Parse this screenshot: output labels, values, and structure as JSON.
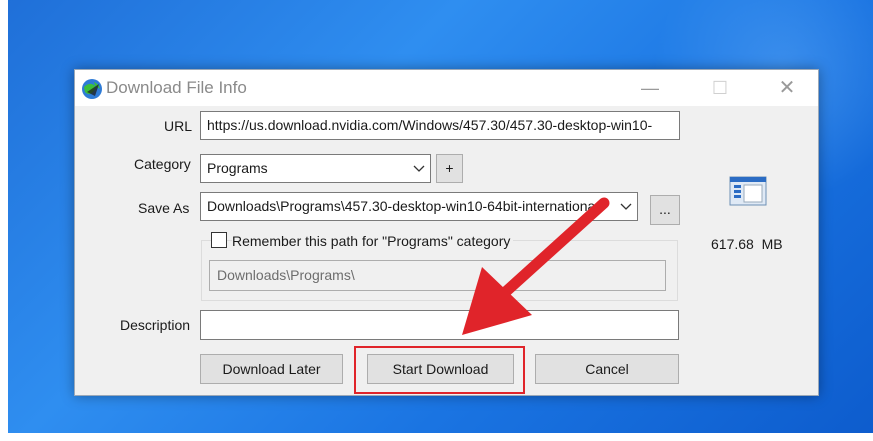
{
  "window": {
    "title": "Download File Info",
    "minimize_glyph": "—",
    "maximize_glyph": "☐",
    "close_glyph": "✕"
  },
  "form": {
    "url_label": "URL",
    "url_value": "https://us.download.nvidia.com/Windows/457.30/457.30-desktop-win10-",
    "category_label": "Category",
    "category_value": "Programs",
    "add_category_label": "+",
    "saveas_label": "Save As",
    "saveas_value": "Downloads\\Programs\\457.30-desktop-win10-64bit-internationa",
    "browse_label": "...",
    "remember_label": "Remember this path for \"Programs\" category",
    "remember_checked": false,
    "remember_path": "Downloads\\Programs\\",
    "description_label": "Description",
    "description_value": "",
    "file_size": "617.68  MB"
  },
  "buttons": {
    "download_later": "Download Later",
    "start_download": "Start Download",
    "cancel": "Cancel"
  },
  "annotation": {
    "arrow_color": "#e0242a",
    "highlight_target": "start_download"
  },
  "icons": {
    "app_icon": "idm-globe-icon",
    "file_type_icon": "file-document-icon",
    "dropdown_icon": "chevron-down-icon"
  }
}
